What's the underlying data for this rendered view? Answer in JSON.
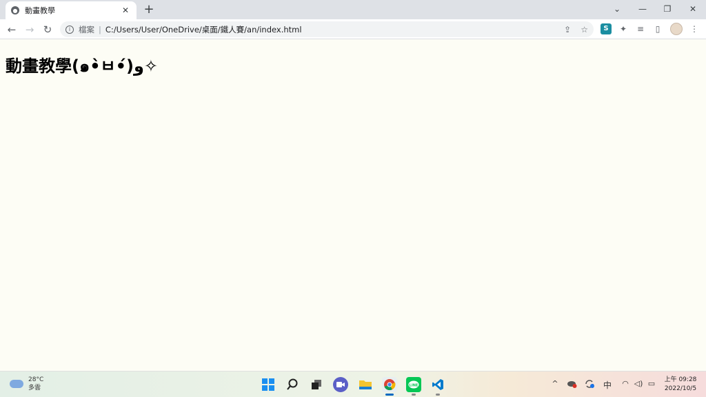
{
  "browser": {
    "tab": {
      "title": "動畫教學",
      "close": "✕"
    },
    "new_tab": "+",
    "window_controls": {
      "dropdown": "⌄",
      "minimize": "—",
      "restore": "❐",
      "close": "✕"
    },
    "nav": {
      "back": "←",
      "forward": "→",
      "reload": "↻"
    },
    "address_bar": {
      "info_icon": "i",
      "site_label": "檔案",
      "separator": "|",
      "url": "C:/Users/User/OneDrive/桌面/鐵人賽/an/index.html",
      "share_icon": "⇪",
      "bookmark_icon": "☆"
    },
    "extensions": {
      "s_badge": "S",
      "puzzle": "✦",
      "reading_list": "≡",
      "side_panel": "▯",
      "menu": "⋮"
    }
  },
  "page": {
    "heading": "動畫教學(๑•̀ㅂ•́)و✧"
  },
  "taskbar": {
    "weather": {
      "temperature": "28°C",
      "condition": "多雲"
    },
    "tray": {
      "chevron": "^",
      "ime": "中",
      "wifi": "◠",
      "volume": "◁)",
      "battery": "▭"
    },
    "clock": {
      "time": "上午 09:28",
      "date": "2022/10/5"
    }
  },
  "colors": {
    "tabstrip": "#dee1e6",
    "page_background": "#fdfdf5",
    "windows_blue": "#0078d4",
    "line_green": "#06c755",
    "vscode_blue": "#007acc"
  }
}
